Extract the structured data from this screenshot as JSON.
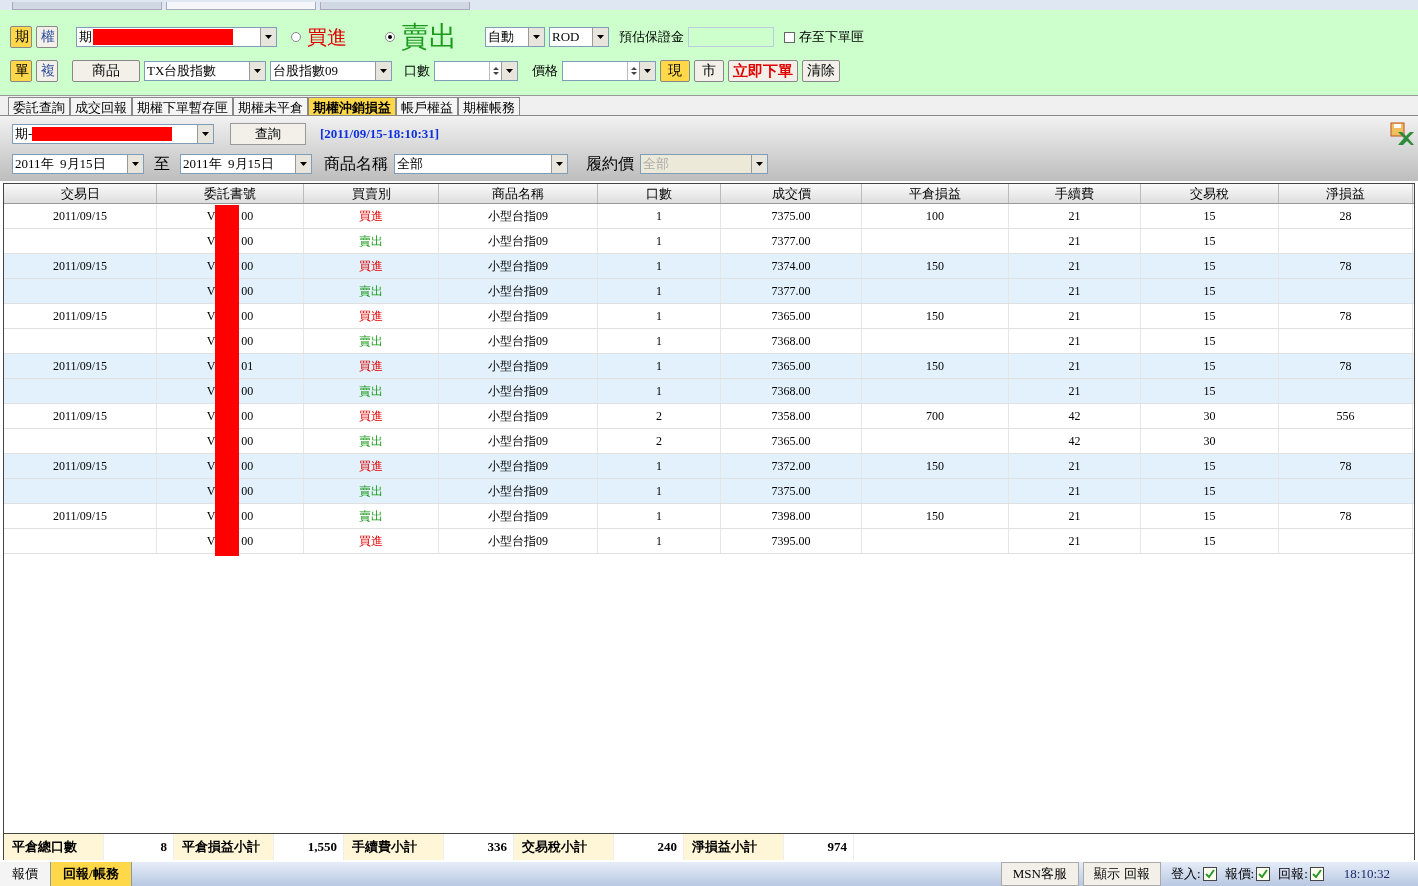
{
  "window_tabs": [
    {
      "selected": false
    },
    {
      "selected": true
    },
    {
      "selected": false
    }
  ],
  "order_panel": {
    "market_buttons": [
      {
        "label": "期",
        "selected": true
      },
      {
        "label": "權",
        "selected": false
      }
    ],
    "mode_buttons": [
      {
        "label": "單",
        "selected": true
      },
      {
        "label": "複",
        "selected": false
      }
    ],
    "account": {
      "value": "期"
    },
    "sides": [
      {
        "label": "買進",
        "kind": "buy",
        "selected": false
      },
      {
        "label": "賣出",
        "kind": "sell",
        "selected": true
      }
    ],
    "condition": "自動",
    "order_type": "ROD",
    "margin_label": "預估保證金",
    "save_to_box": {
      "label": "存至下單匣",
      "checked": false
    },
    "product_button": "商品",
    "product": "TX台股指數",
    "contract": "台股指數09",
    "qty_label": "口數",
    "price_label": "價格",
    "price_buttons": [
      {
        "label": "現",
        "selected": true
      },
      {
        "label": "市",
        "selected": false
      }
    ],
    "submit": "立即下單",
    "clear": "清除"
  },
  "tabs": [
    {
      "label": "委託查詢",
      "selected": false
    },
    {
      "label": "成交回報",
      "selected": false
    },
    {
      "label": "期權下單暫存匣",
      "selected": false
    },
    {
      "label": "期權未平倉",
      "selected": false
    },
    {
      "label": "期權沖銷損益",
      "selected": true
    },
    {
      "label": "帳戶權益",
      "selected": false
    },
    {
      "label": "期權帳務",
      "selected": false
    }
  ],
  "query": {
    "account": "期-",
    "button": "查詢",
    "timestamp": "[2011/09/15-18:10:31]",
    "date_from": "2011年  9月15日",
    "to_label": "至",
    "date_to": "2011年  9月15日",
    "product_label": "商品名稱",
    "product": "全部",
    "strike_label": "履約價",
    "strike": "全部"
  },
  "table": {
    "columns": [
      "交易日",
      "委託書號",
      "買賣別",
      "商品名稱",
      "口數",
      "成交價",
      "平倉損益",
      "手續費",
      "交易稅",
      "淨損益"
    ],
    "rows": [
      {
        "date": "2011/09/15",
        "order_start": "V",
        "order_end": "00",
        "side": "買進",
        "kind": "buy",
        "product": "小型台指09",
        "qty": "1",
        "price": "7375.00",
        "pnl": "100",
        "fee": "21",
        "tax": "15",
        "net": "28",
        "shaded": false
      },
      {
        "date": "",
        "order_start": "V",
        "order_end": "00",
        "side": "賣出",
        "kind": "sell",
        "product": "小型台指09",
        "qty": "1",
        "price": "7377.00",
        "pnl": "",
        "fee": "21",
        "tax": "15",
        "net": "",
        "shaded": false
      },
      {
        "date": "2011/09/15",
        "order_start": "V",
        "order_end": "00",
        "side": "買進",
        "kind": "buy",
        "product": "小型台指09",
        "qty": "1",
        "price": "7374.00",
        "pnl": "150",
        "fee": "21",
        "tax": "15",
        "net": "78",
        "shaded": true
      },
      {
        "date": "",
        "order_start": "V",
        "order_end": "00",
        "side": "賣出",
        "kind": "sell",
        "product": "小型台指09",
        "qty": "1",
        "price": "7377.00",
        "pnl": "",
        "fee": "21",
        "tax": "15",
        "net": "",
        "shaded": true
      },
      {
        "date": "2011/09/15",
        "order_start": "V",
        "order_end": "00",
        "side": "買進",
        "kind": "buy",
        "product": "小型台指09",
        "qty": "1",
        "price": "7365.00",
        "pnl": "150",
        "fee": "21",
        "tax": "15",
        "net": "78",
        "shaded": false
      },
      {
        "date": "",
        "order_start": "V",
        "order_end": "00",
        "side": "賣出",
        "kind": "sell",
        "product": "小型台指09",
        "qty": "1",
        "price": "7368.00",
        "pnl": "",
        "fee": "21",
        "tax": "15",
        "net": "",
        "shaded": false
      },
      {
        "date": "2011/09/15",
        "order_start": "V",
        "order_end": "01",
        "side": "買進",
        "kind": "buy",
        "product": "小型台指09",
        "qty": "1",
        "price": "7365.00",
        "pnl": "150",
        "fee": "21",
        "tax": "15",
        "net": "78",
        "shaded": true
      },
      {
        "date": "",
        "order_start": "V",
        "order_end": "00",
        "side": "賣出",
        "kind": "sell",
        "product": "小型台指09",
        "qty": "1",
        "price": "7368.00",
        "pnl": "",
        "fee": "21",
        "tax": "15",
        "net": "",
        "shaded": true
      },
      {
        "date": "2011/09/15",
        "order_start": "V",
        "order_end": "00",
        "side": "買進",
        "kind": "buy",
        "product": "小型台指09",
        "qty": "2",
        "price": "7358.00",
        "pnl": "700",
        "fee": "42",
        "tax": "30",
        "net": "556",
        "shaded": false
      },
      {
        "date": "",
        "order_start": "V",
        "order_end": "00",
        "side": "賣出",
        "kind": "sell",
        "product": "小型台指09",
        "qty": "2",
        "price": "7365.00",
        "pnl": "",
        "fee": "42",
        "tax": "30",
        "net": "",
        "shaded": false
      },
      {
        "date": "2011/09/15",
        "order_start": "V",
        "order_end": "00",
        "side": "買進",
        "kind": "buy",
        "product": "小型台指09",
        "qty": "1",
        "price": "7372.00",
        "pnl": "150",
        "fee": "21",
        "tax": "15",
        "net": "78",
        "shaded": true
      },
      {
        "date": "",
        "order_start": "V",
        "order_end": "00",
        "side": "賣出",
        "kind": "sell",
        "product": "小型台指09",
        "qty": "1",
        "price": "7375.00",
        "pnl": "",
        "fee": "21",
        "tax": "15",
        "net": "",
        "shaded": true
      },
      {
        "date": "2011/09/15",
        "order_start": "V",
        "order_end": "00",
        "side": "賣出",
        "kind": "sell",
        "product": "小型台指09",
        "qty": "1",
        "price": "7398.00",
        "pnl": "150",
        "fee": "21",
        "tax": "15",
        "net": "78",
        "shaded": false
      },
      {
        "date": "",
        "order_start": "V",
        "order_end": "00",
        "side": "買進",
        "kind": "buy",
        "product": "小型台指09",
        "qty": "1",
        "price": "7395.00",
        "pnl": "",
        "fee": "21",
        "tax": "15",
        "net": "",
        "shaded": false
      }
    ]
  },
  "summary": [
    {
      "label": "平倉總口數",
      "value": "8"
    },
    {
      "label": "平倉損益小計",
      "value": "1,550"
    },
    {
      "label": "手續費小計",
      "value": "336"
    },
    {
      "label": "交易稅小計",
      "value": "240"
    },
    {
      "label": "淨損益小計",
      "value": "974"
    }
  ],
  "bottom_tabs": [
    {
      "label": "報價",
      "selected": false
    },
    {
      "label": "回報/帳務",
      "selected": true
    }
  ],
  "status": {
    "buttons": [
      "MSN客服",
      "顯示 回報"
    ],
    "indicators": [
      {
        "label": "登入:",
        "checked": true
      },
      {
        "label": "報價:",
        "checked": true
      },
      {
        "label": "回報:",
        "checked": true
      }
    ],
    "time": "18:10:32"
  }
}
